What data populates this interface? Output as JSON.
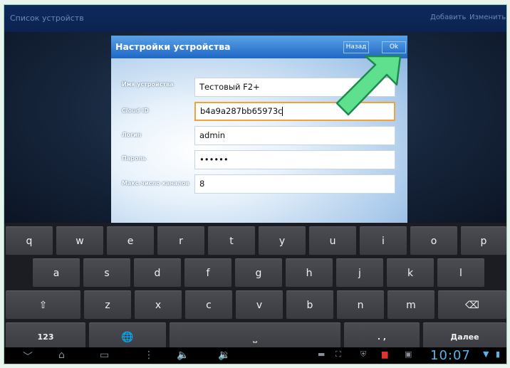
{
  "app": {
    "title": "Список устройств",
    "add_label": "Добавить",
    "edit_label": "Изменить"
  },
  "dialog": {
    "title": "Настройки устройства",
    "back_label": "Назад",
    "ok_label": "Ok",
    "fields": [
      {
        "label": "Имя устройства",
        "value": "Тестовый F2+"
      },
      {
        "label": "Cloud ID",
        "value": "b4a9a287bb65973c"
      },
      {
        "label": "Логин",
        "value": "admin"
      },
      {
        "label": "Пароль",
        "value": "••••••"
      },
      {
        "label": "Макс.число каналов",
        "value": "8"
      }
    ]
  },
  "keyboard": {
    "row1": [
      "q",
      "w",
      "e",
      "r",
      "t",
      "y",
      "u",
      "i",
      "o",
      "p"
    ],
    "row2": [
      "a",
      "s",
      "d",
      "f",
      "g",
      "h",
      "j",
      "k",
      "l"
    ],
    "row3": [
      "z",
      "x",
      "c",
      "v",
      "b",
      "n",
      "m"
    ],
    "num_label": "123",
    "space_label": "⎵",
    "punct_label": ". ,",
    "next_label": "Далее",
    "shift_icon": "⇧",
    "backspace_icon": "⌫",
    "globe_icon": "🌐"
  },
  "statusbar": {
    "time": "10:07"
  },
  "colors": {
    "accent_arrow": "#5fe08f",
    "input_focus": "#f1a23a",
    "dialog_header": "#2f7bd3",
    "clock": "#58b3e8"
  }
}
